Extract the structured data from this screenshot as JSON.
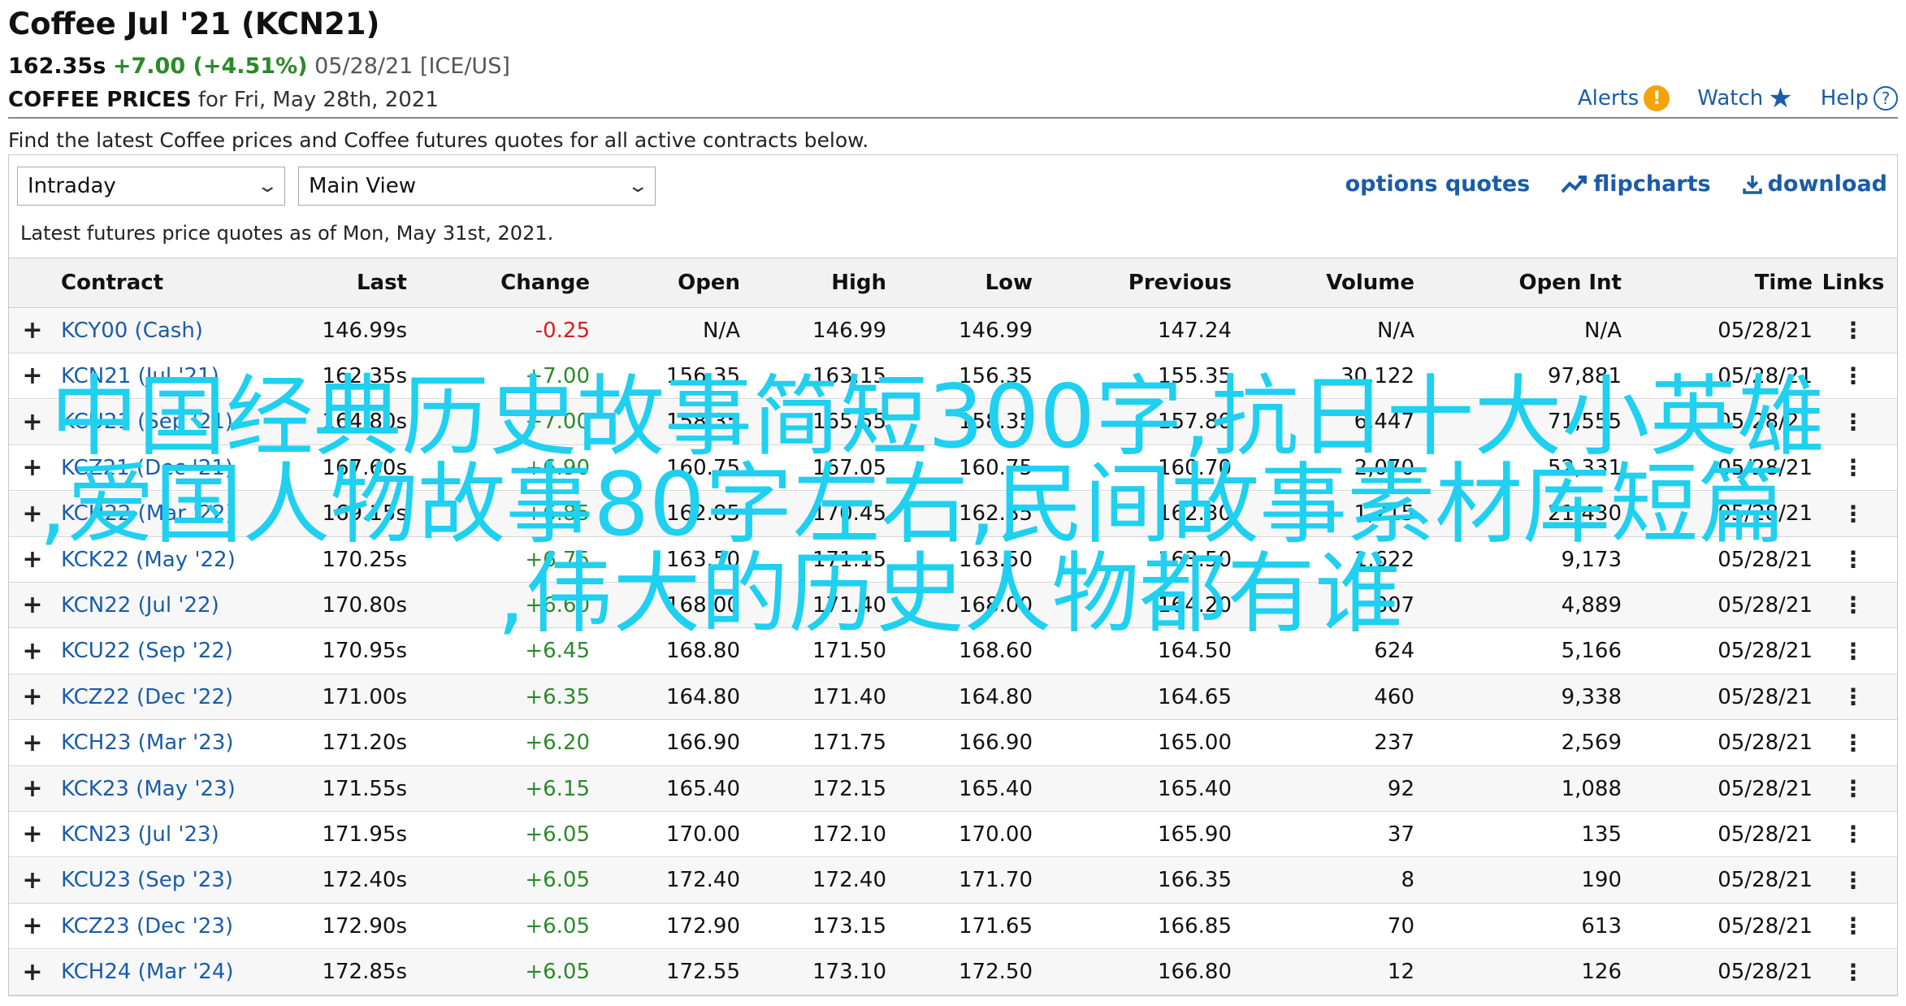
{
  "header": {
    "title": "Coffee Jul '21 (KCN21)",
    "price": "162.35s",
    "change": "+7.00 (+4.51%)",
    "date_exchange": "05/28/21 [ICE/US]",
    "subtitle_bold": "COFFEE PRICES",
    "subtitle_rest": " for Fri, May 28th, 2021"
  },
  "top_links": {
    "alerts": "Alerts",
    "watch": "Watch",
    "help": "Help"
  },
  "description": "Find the latest Coffee prices and Coffee futures quotes for all active contracts below.",
  "controls": {
    "period_select": "Intraday",
    "view_select": "Main View"
  },
  "actions": {
    "options_quotes": "options quotes",
    "flipcharts": "flipcharts",
    "download": "download"
  },
  "as_of": "Latest futures price quotes as of Mon, May 31st, 2021.",
  "table": {
    "columns": [
      "Contract",
      "Last",
      "Change",
      "Open",
      "High",
      "Low",
      "Previous",
      "Volume",
      "Open Int",
      "Time",
      "Links"
    ],
    "rows": [
      {
        "contract": "KCY00 (Cash)",
        "last": "146.99s",
        "change": "-0.25",
        "open": "N/A",
        "high": "146.99",
        "low": "146.99",
        "previous": "147.24",
        "volume": "N/A",
        "open_int": "N/A",
        "time": "05/28/21"
      },
      {
        "contract": "KCN21 (Jul '21)",
        "last": "162.35s",
        "change": "+7.00",
        "open": "156.35",
        "high": "163.15",
        "low": "156.35",
        "previous": "155.35",
        "volume": "30,122",
        "open_int": "97,881",
        "time": "05/28/21"
      },
      {
        "contract": "KCU21 (Sep '21)",
        "last": "164.80s",
        "change": "+7.00",
        "open": "158.35",
        "high": "165.55",
        "low": "158.35",
        "previous": "157.80",
        "volume": "6,447",
        "open_int": "71,555",
        "time": "05/28/21"
      },
      {
        "contract": "KCZ21 (Dec '21)",
        "last": "167.60s",
        "change": "+6.90",
        "open": "160.75",
        "high": "167.05",
        "low": "160.75",
        "previous": "160.70",
        "volume": "2,070",
        "open_int": "52,331",
        "time": "05/28/21"
      },
      {
        "contract": "KCH22 (Mar '22)",
        "last": "169.15s",
        "change": "+6.85",
        "open": "162.85",
        "high": "170.45",
        "low": "162.85",
        "previous": "162.30",
        "volume": "1,215",
        "open_int": "21,430",
        "time": "05/28/21"
      },
      {
        "contract": "KCK22 (May '22)",
        "last": "170.25s",
        "change": "+6.75",
        "open": "163.50",
        "high": "171.15",
        "low": "163.50",
        "previous": "163.50",
        "volume": "1,622",
        "open_int": "9,173",
        "time": "05/28/21"
      },
      {
        "contract": "KCN22 (Jul '22)",
        "last": "170.80s",
        "change": "+6.60",
        "open": "168.00",
        "high": "171.40",
        "low": "168.00",
        "previous": "164.20",
        "volume": "807",
        "open_int": "4,889",
        "time": "05/28/21"
      },
      {
        "contract": "KCU22 (Sep '22)",
        "last": "170.95s",
        "change": "+6.45",
        "open": "168.80",
        "high": "171.50",
        "low": "168.60",
        "previous": "164.50",
        "volume": "624",
        "open_int": "5,166",
        "time": "05/28/21"
      },
      {
        "contract": "KCZ22 (Dec '22)",
        "last": "171.00s",
        "change": "+6.35",
        "open": "164.80",
        "high": "171.40",
        "low": "164.80",
        "previous": "164.65",
        "volume": "460",
        "open_int": "9,338",
        "time": "05/28/21"
      },
      {
        "contract": "KCH23 (Mar '23)",
        "last": "171.20s",
        "change": "+6.20",
        "open": "166.90",
        "high": "171.75",
        "low": "166.90",
        "previous": "165.00",
        "volume": "237",
        "open_int": "2,569",
        "time": "05/28/21"
      },
      {
        "contract": "KCK23 (May '23)",
        "last": "171.55s",
        "change": "+6.15",
        "open": "165.40",
        "high": "172.15",
        "low": "165.40",
        "previous": "165.40",
        "volume": "92",
        "open_int": "1,088",
        "time": "05/28/21"
      },
      {
        "contract": "KCN23 (Jul '23)",
        "last": "171.95s",
        "change": "+6.05",
        "open": "170.00",
        "high": "172.10",
        "low": "170.00",
        "previous": "165.90",
        "volume": "37",
        "open_int": "135",
        "time": "05/28/21"
      },
      {
        "contract": "KCU23 (Sep '23)",
        "last": "172.40s",
        "change": "+6.05",
        "open": "172.40",
        "high": "172.40",
        "low": "171.70",
        "previous": "166.35",
        "volume": "8",
        "open_int": "190",
        "time": "05/28/21"
      },
      {
        "contract": "KCZ23 (Dec '23)",
        "last": "172.90s",
        "change": "+6.05",
        "open": "172.90",
        "high": "173.15",
        "low": "171.65",
        "previous": "166.85",
        "volume": "70",
        "open_int": "613",
        "time": "05/28/21"
      },
      {
        "contract": "KCH24 (Mar '24)",
        "last": "172.85s",
        "change": "+6.05",
        "open": "172.55",
        "high": "173.10",
        "low": "172.50",
        "previous": "166.80",
        "volume": "12",
        "open_int": "126",
        "time": "05/28/21"
      }
    ]
  },
  "overlay_text": {
    "line1": "中国经典历史故事简短300字,抗日十大小英雄",
    "line2": ",爱国人物故事80字左右,民间故事素材库短篇",
    "line3": ",伟大的历史人物都有谁"
  },
  "colors": {
    "link": "#1a5ca8",
    "positive": "#2a8a2a",
    "negative": "#d62020",
    "overlay": "#1fd0f0",
    "alert": "#f5a30a"
  }
}
